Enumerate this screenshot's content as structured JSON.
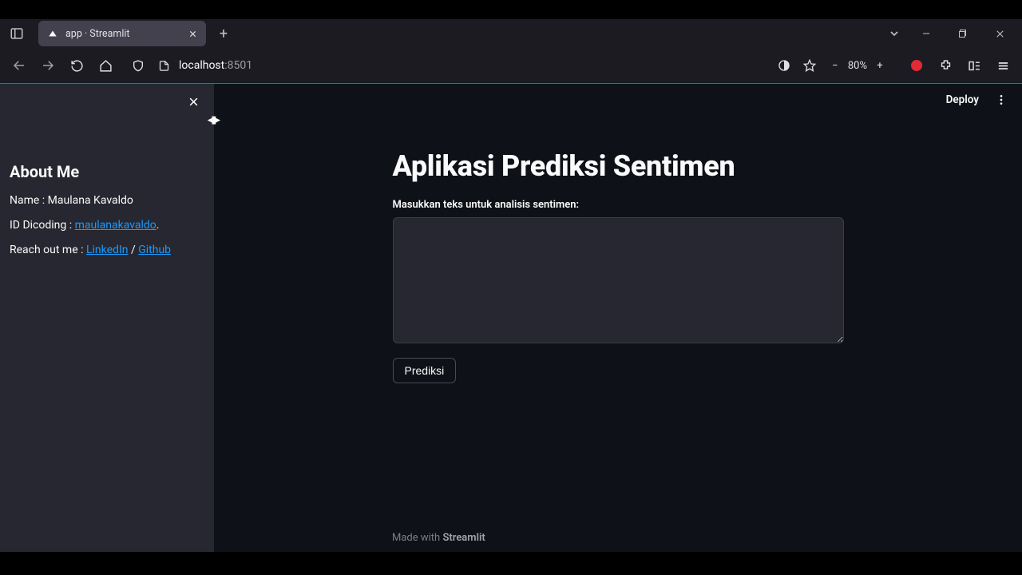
{
  "browser": {
    "tab_title": "app · Streamlit",
    "url_host": "localhost",
    "url_port": ":8501",
    "zoom": "80%"
  },
  "streamlit": {
    "topbar": {
      "deploy": "Deploy"
    },
    "sidebar": {
      "heading": "About Me",
      "name_label": "Name : ",
      "name_value": "Maulana Kavaldo",
      "id_label": "ID Dicoding : ",
      "id_link": "maulanakavaldo",
      "id_dot": ".",
      "reach_label": "Reach out me : ",
      "linkedin": "LinkedIn",
      "sep": " / ",
      "github": "Github"
    },
    "main": {
      "title": "Aplikasi Prediksi Sentimen",
      "input_label": "Masukkan teks untuk analisis sentimen:",
      "textarea_value": "",
      "predict_button": "Prediksi"
    },
    "footer_prefix": "Made with ",
    "footer_brand": "Streamlit"
  }
}
